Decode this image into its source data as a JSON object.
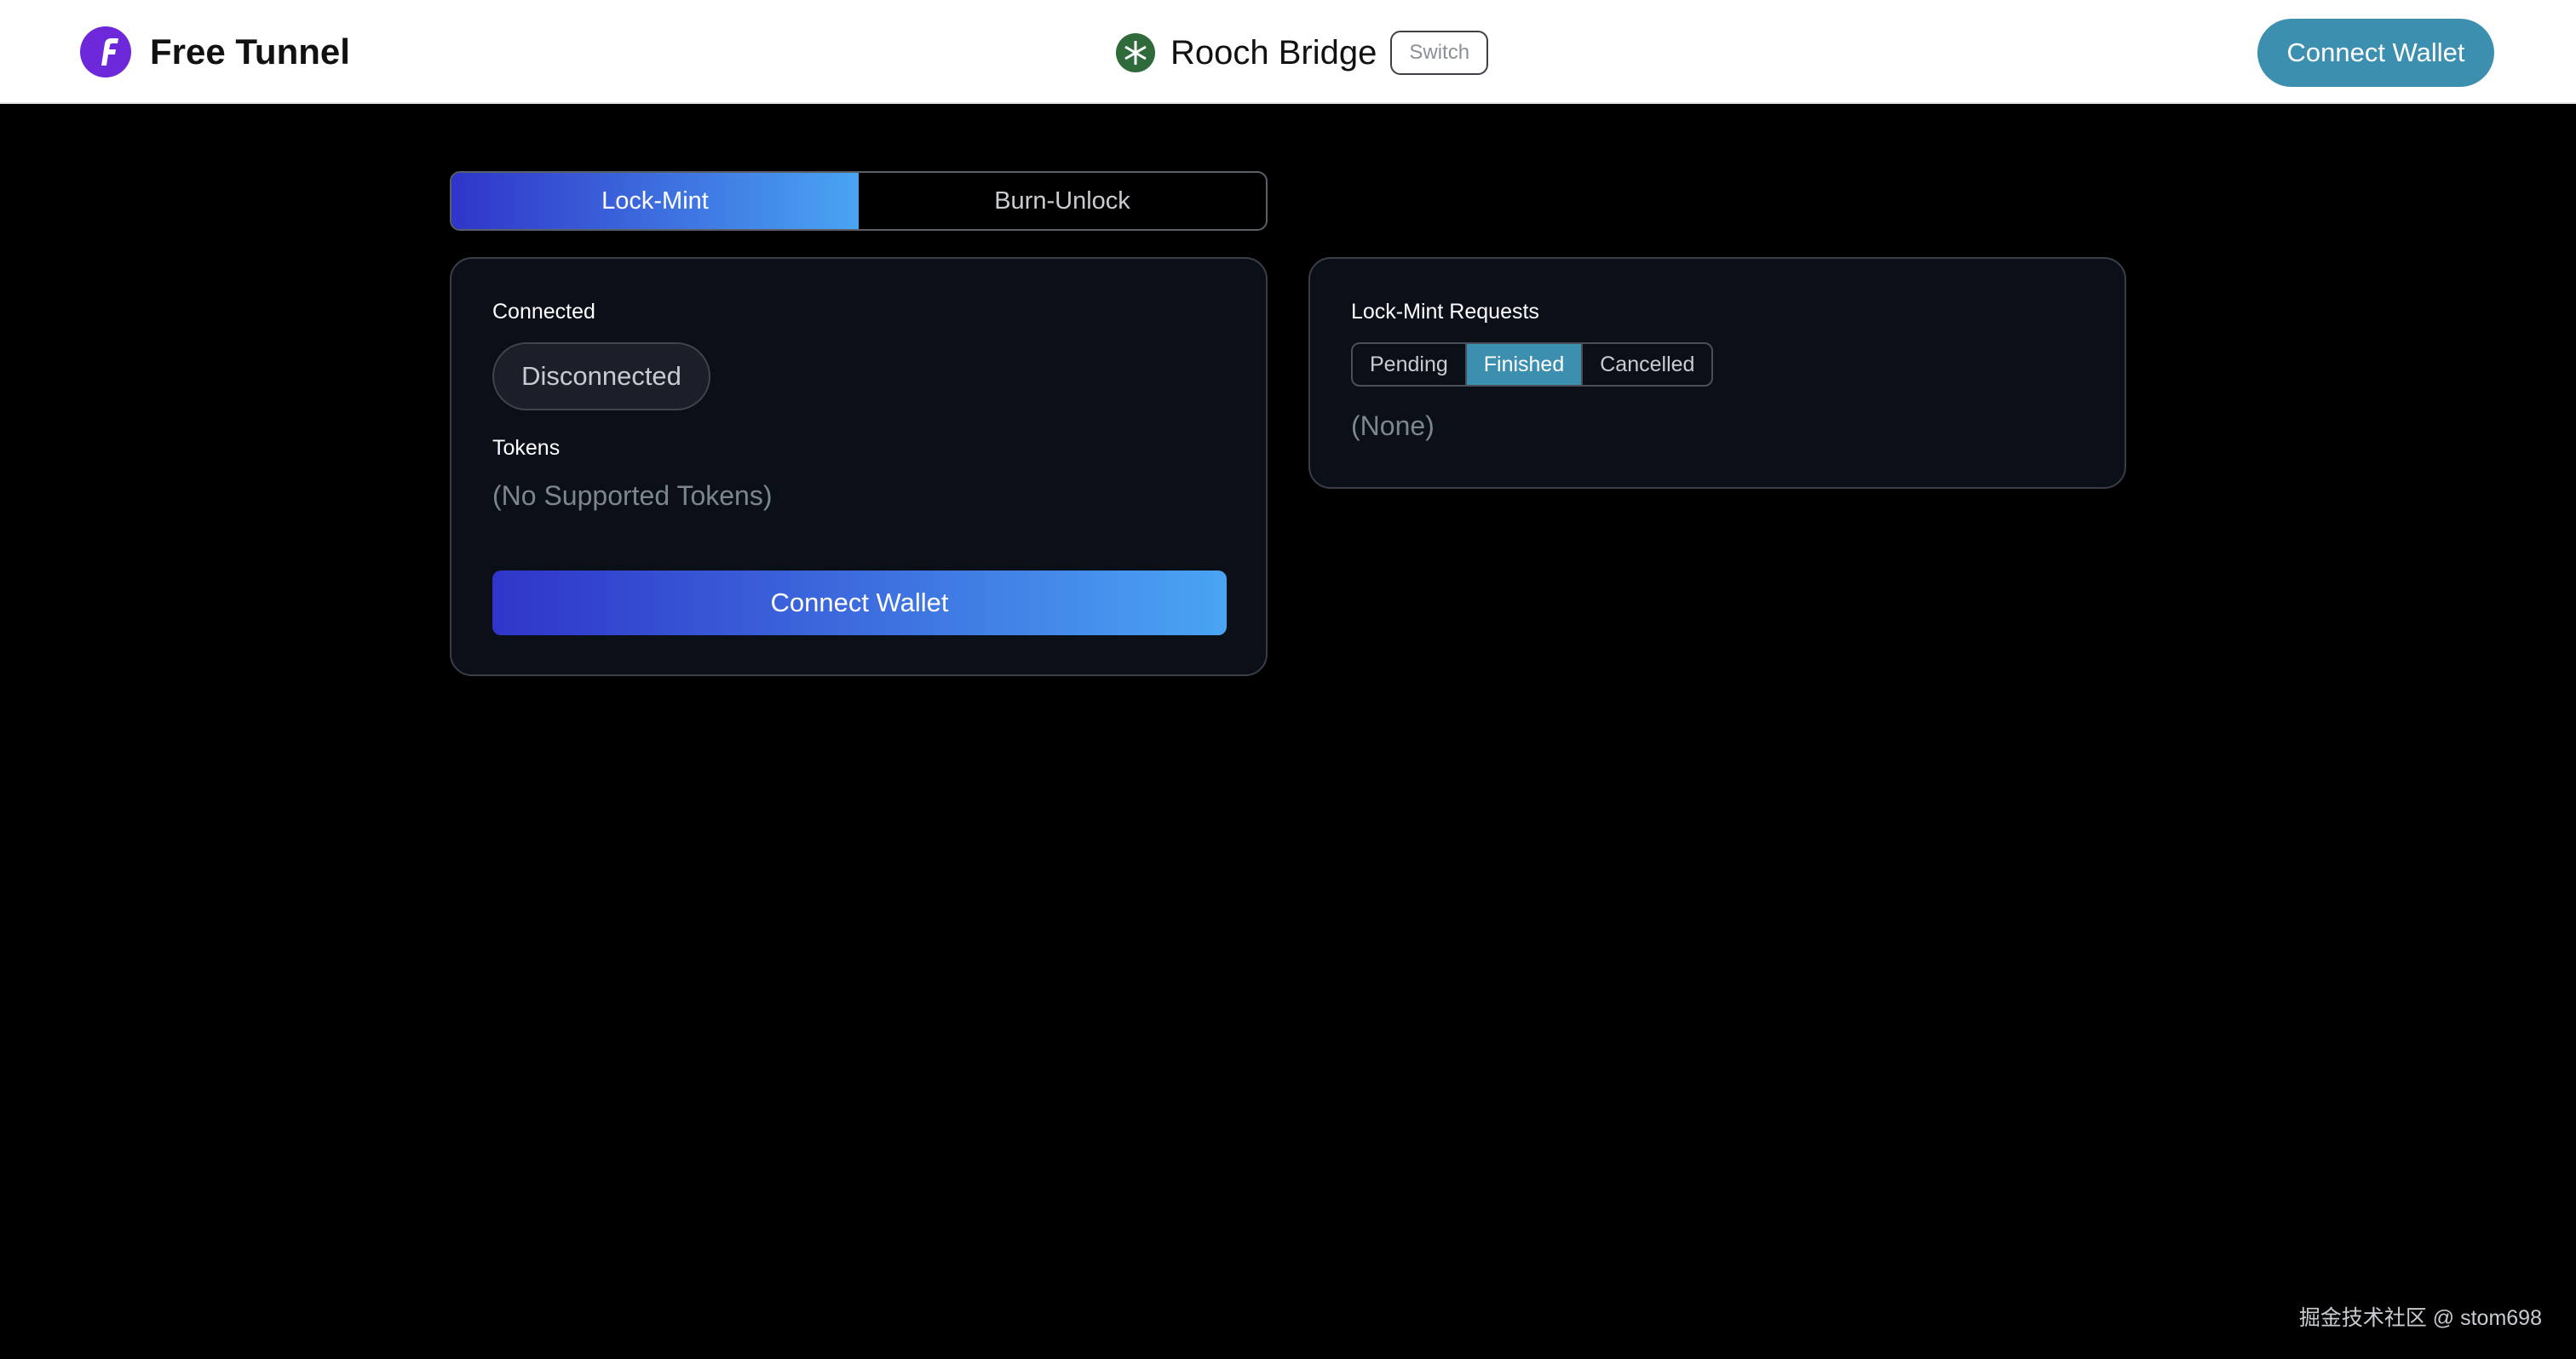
{
  "header": {
    "brand_name": "Free Tunnel",
    "bridge_name": "Rooch Bridge",
    "switch_label": "Switch",
    "connect_wallet_label": "Connect Wallet"
  },
  "mode_tabs": [
    {
      "label": "Lock-Mint",
      "active": true
    },
    {
      "label": "Burn-Unlock",
      "active": false
    }
  ],
  "lock_mint_form": {
    "connected_label": "Connected",
    "connection_status": "Disconnected",
    "tokens_label": "Tokens",
    "tokens_empty": "(No Supported Tokens)",
    "connect_wallet_label": "Connect Wallet"
  },
  "requests_panel": {
    "title": "Lock-Mint Requests",
    "filters": [
      {
        "label": "Pending",
        "active": false
      },
      {
        "label": "Finished",
        "active": true
      },
      {
        "label": "Cancelled",
        "active": false
      }
    ],
    "empty_text": "(None)"
  },
  "watermark": "掘金技术社区 @ stom698",
  "colors": {
    "accent": "#3d8fb0",
    "gradient_start": "#2f35c9",
    "gradient_end": "#4aa4f3",
    "brand_logo": "#6d28d9",
    "bridge_icon": "#2f6b3a"
  }
}
